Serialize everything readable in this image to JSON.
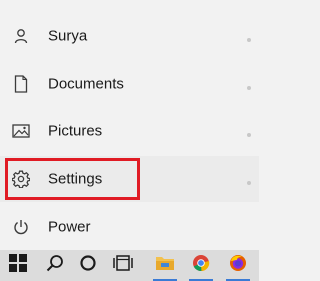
{
  "menu": {
    "items": [
      {
        "label": "Surya",
        "icon": "user-icon"
      },
      {
        "label": "Documents",
        "icon": "document-icon"
      },
      {
        "label": "Pictures",
        "icon": "pictures-icon"
      },
      {
        "label": "Settings",
        "icon": "gear-icon"
      },
      {
        "label": "Power",
        "icon": "power-icon"
      }
    ],
    "highlighted_item": "Settings"
  },
  "taskbar": {
    "items": [
      {
        "icon": "windows-start-icon"
      },
      {
        "icon": "search-icon"
      },
      {
        "icon": "cortana-icon"
      },
      {
        "icon": "task-view-icon"
      },
      {
        "icon": "file-explorer-icon"
      },
      {
        "icon": "chrome-icon"
      },
      {
        "icon": "firefox-icon"
      }
    ]
  },
  "colors": {
    "menu_background": "#f2f2f2",
    "selected_background": "#ebebeb",
    "highlight_border": "#e01b24",
    "taskbar_background": "#dcdcdc",
    "text": "#1a1a1a"
  }
}
